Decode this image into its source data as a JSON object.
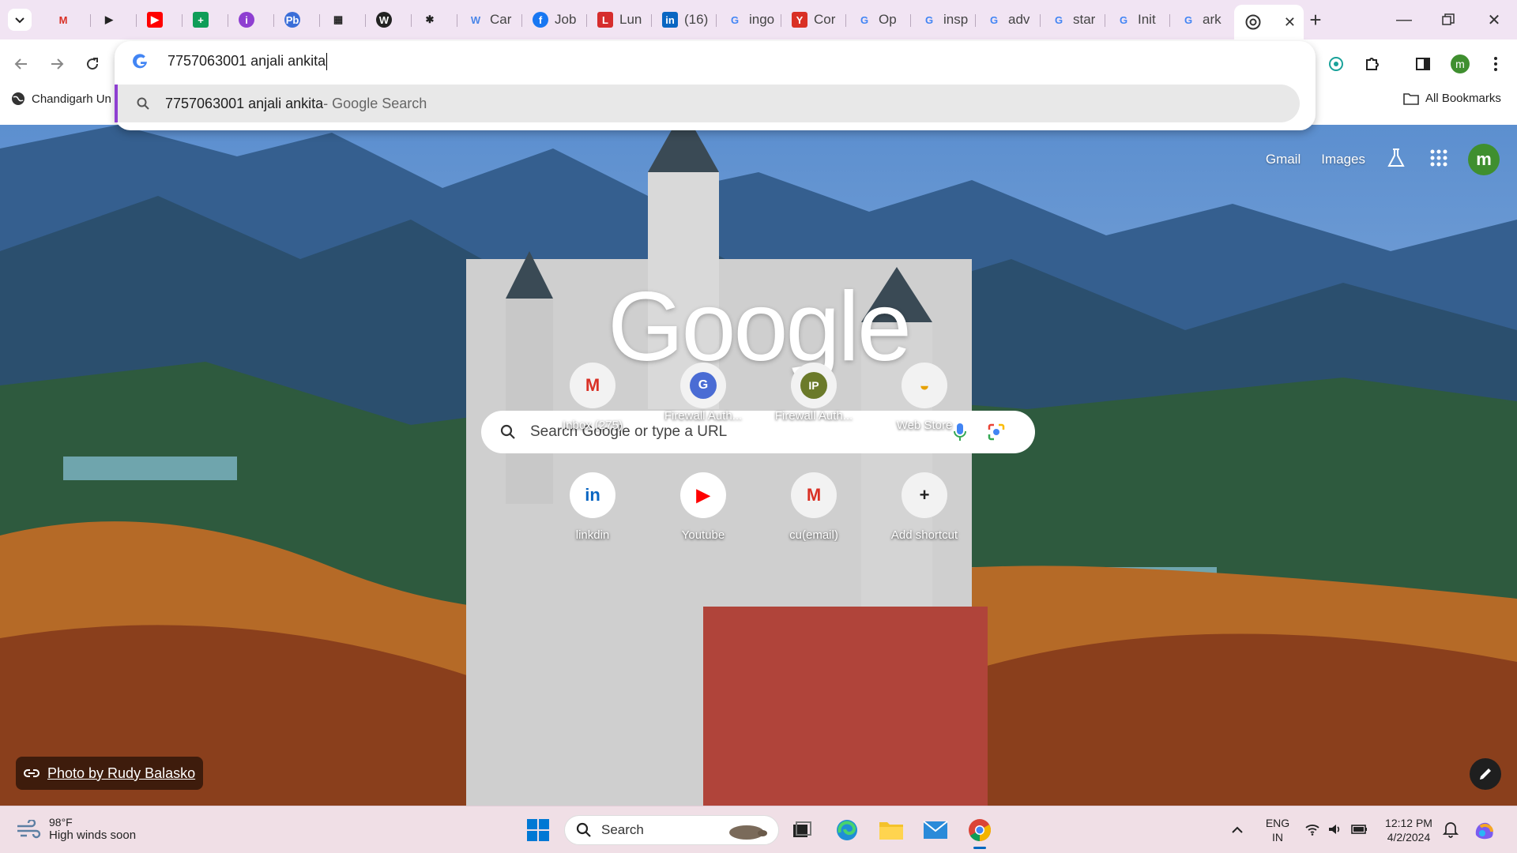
{
  "browser": {
    "tabs": [
      {
        "label": "",
        "icon": "gmail-icon"
      },
      {
        "label": "",
        "icon": "play-icon"
      },
      {
        "label": "",
        "icon": "youtube-icon"
      },
      {
        "label": "",
        "icon": "sheets-add-icon"
      },
      {
        "label": "",
        "icon": "info-circle-icon"
      },
      {
        "label": "",
        "icon": "pb-icon"
      },
      {
        "label": "",
        "icon": "calculator-icon"
      },
      {
        "label": "",
        "icon": "wordpress-icon"
      },
      {
        "label": "",
        "icon": "asterisk-icon"
      },
      {
        "label": "Car",
        "icon": "w-icon"
      },
      {
        "label": "Job",
        "icon": "facebook-icon"
      },
      {
        "label": "Lun",
        "icon": "l-icon"
      },
      {
        "label": "(16)",
        "icon": "linkedin-icon"
      },
      {
        "label": "ingo",
        "icon": "google-icon"
      },
      {
        "label": "Cor",
        "icon": "y-icon"
      },
      {
        "label": "Op",
        "icon": "google-icon"
      },
      {
        "label": "insp",
        "icon": "google-icon"
      },
      {
        "label": "adv",
        "icon": "google-icon"
      },
      {
        "label": "star",
        "icon": "google-icon"
      },
      {
        "label": "Init",
        "icon": "google-icon"
      },
      {
        "label": "ark",
        "icon": "google-icon"
      }
    ],
    "active_tab": {
      "icon": "chrome-icon",
      "close": "✕"
    },
    "omnibox": {
      "value": "7757063001 anjali ankita",
      "suggestion_query": "7757063001 anjali ankita",
      "suggestion_source": " - Google Search"
    },
    "bookmarks": {
      "item1": "Chandigarh Un",
      "all_bookmarks": "All Bookmarks"
    },
    "profile_initial": "m"
  },
  "newtab": {
    "top_links": {
      "gmail": "Gmail",
      "images": "Images"
    },
    "logo": "Google",
    "search_placeholder": "Search Google or type a URL",
    "shortcuts": [
      {
        "label": "Inbox (275)",
        "glyph": "M",
        "color": "#d93025"
      },
      {
        "label": "Firewall Auth...",
        "glyph": "G",
        "color": "#4a6cd4"
      },
      {
        "label": "Firewall Auth...",
        "glyph": "IP",
        "color": "#6b7a2a"
      },
      {
        "label": "Web Store",
        "glyph": "◒",
        "color": "#e6a100"
      },
      {
        "label": "linkdin",
        "glyph": "in",
        "color": "#0a66c2"
      },
      {
        "label": "Youtube",
        "glyph": "▶",
        "color": "#ff0000"
      },
      {
        "label": "cu(email)",
        "glyph": "M",
        "color": "#d93025"
      },
      {
        "label": "Add shortcut",
        "glyph": "+",
        "color": "#222222"
      }
    ],
    "photo_credit": "Photo by Rudy Balasko"
  },
  "taskbar": {
    "weather_temp": "98°F",
    "weather_cond": "High winds soon",
    "search_label": "Search",
    "lang1": "ENG",
    "lang2": "IN",
    "time": "12:12 PM",
    "date": "4/2/2024"
  }
}
